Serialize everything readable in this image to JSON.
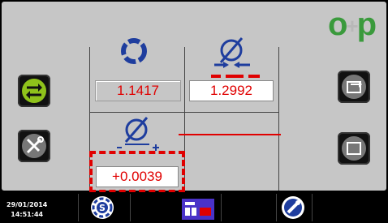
{
  "panel": {
    "values": {
      "left_measure": "1.1417",
      "right_measure": "1.2992",
      "difference": "+0.0039"
    }
  },
  "logo": {
    "text": "o+p"
  },
  "status": {
    "date": "29/01/2014",
    "time": "14:51:44"
  },
  "icons": {
    "top_left_header": "ring-dial-icon",
    "top_right_header": "diameter-compress-icon",
    "middle_header": "diameter-difference-icon",
    "left_button_1": "swap-arrows-icon",
    "left_button_2": "tools-icon",
    "right_button_1": "export-icon",
    "right_button_2": "frame-icon",
    "bottom_1": "settings-s-icon",
    "bottom_2": "machine-icon",
    "bottom_3": "wrench-icon"
  },
  "colors": {
    "accent_green": "#3a9a3c",
    "value_red": "#e00000",
    "panel_grey": "#c6c6c6"
  }
}
